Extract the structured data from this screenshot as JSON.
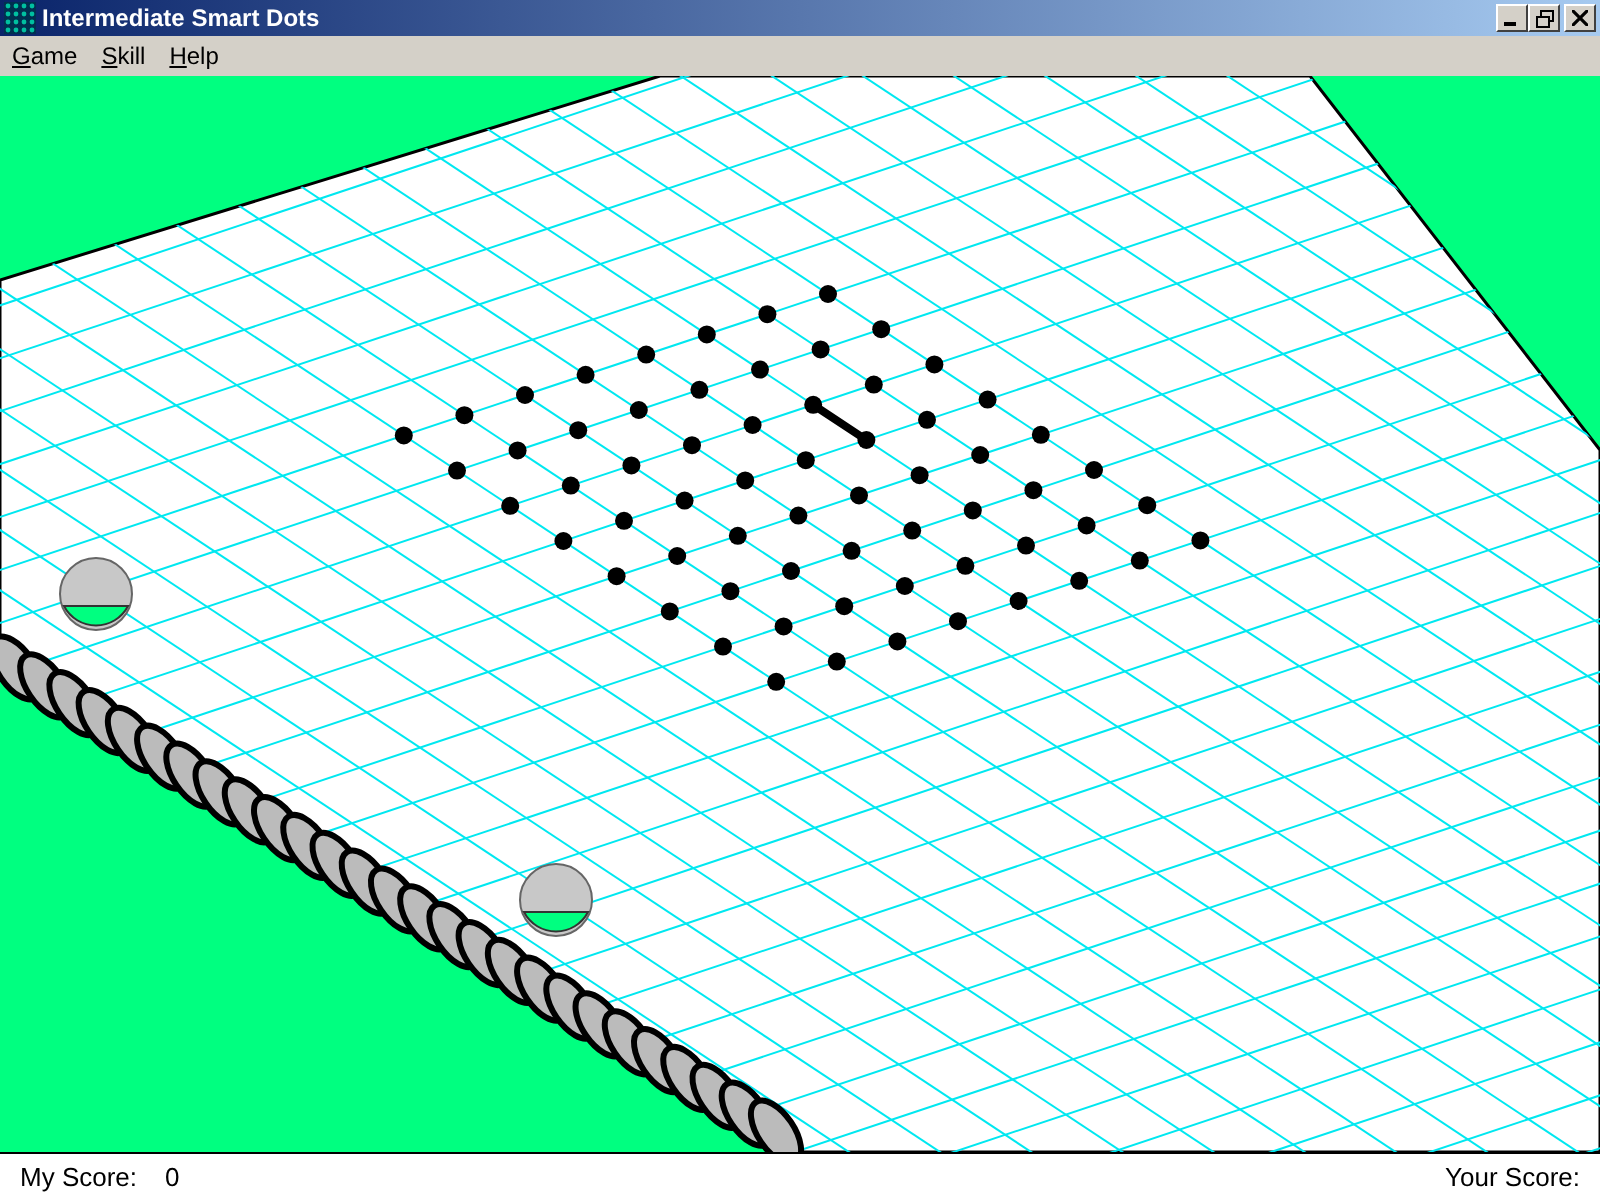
{
  "window": {
    "title": "Intermediate Smart Dots"
  },
  "menu": [
    {
      "label": "Game"
    },
    {
      "label": "Skill"
    },
    {
      "label": "Help"
    }
  ],
  "board": {
    "rows": [
      {
        "dots": [
          {
            "linked": false
          },
          {
            "linked": false
          },
          {
            "linked": false
          },
          {
            "linked": false
          },
          {
            "linked": false
          },
          {
            "linked": false
          },
          {
            "linked": false
          },
          {
            "linked": false
          }
        ]
      },
      {
        "dots": [
          {
            "linked": false
          },
          {
            "linked": false
          },
          {
            "linked": false
          },
          {
            "linked": false
          },
          {
            "linked": false
          },
          {
            "linked": false
          },
          {
            "linked": false
          },
          {
            "linked": false
          }
        ]
      },
      {
        "dots": [
          {
            "linked": false
          },
          {
            "linked": false
          },
          {
            "linked": true
          },
          {
            "linked": false
          },
          {
            "linked": false
          },
          {
            "linked": false
          },
          {
            "linked": false
          },
          {
            "linked": false
          }
        ]
      },
      {
        "dots": [
          {
            "linked": false
          },
          {
            "linked": false
          },
          {
            "linked": false
          },
          {
            "linked": false
          },
          {
            "linked": false
          },
          {
            "linked": false
          },
          {
            "linked": false
          },
          {
            "linked": false
          }
        ]
      },
      {
        "dots": [
          {
            "linked": false
          },
          {
            "linked": false
          },
          {
            "linked": false
          },
          {
            "linked": false
          },
          {
            "linked": false
          },
          {
            "linked": false
          },
          {
            "linked": false
          },
          {
            "linked": false
          }
        ]
      },
      {
        "dots": [
          {
            "linked": false
          },
          {
            "linked": false
          },
          {
            "linked": false
          },
          {
            "linked": false
          },
          {
            "linked": false
          },
          {
            "linked": false
          },
          {
            "linked": false
          },
          {
            "linked": false
          }
        ]
      },
      {
        "dots": [
          {
            "linked": false
          },
          {
            "linked": false
          },
          {
            "linked": false
          },
          {
            "linked": false
          },
          {
            "linked": false
          },
          {
            "linked": false
          },
          {
            "linked": false
          },
          {
            "linked": false
          }
        ]
      },
      {
        "dots": [
          {
            "linked": false
          },
          {
            "linked": false
          },
          {
            "linked": false
          },
          {
            "linked": false
          },
          {
            "linked": false
          },
          {
            "linked": false
          },
          {
            "linked": false
          },
          {
            "linked": false
          }
        ]
      }
    ]
  },
  "status_bar": {
    "my_score_label": "My Score:",
    "my_score": "0",
    "your_score_label": "Your Score:"
  }
}
